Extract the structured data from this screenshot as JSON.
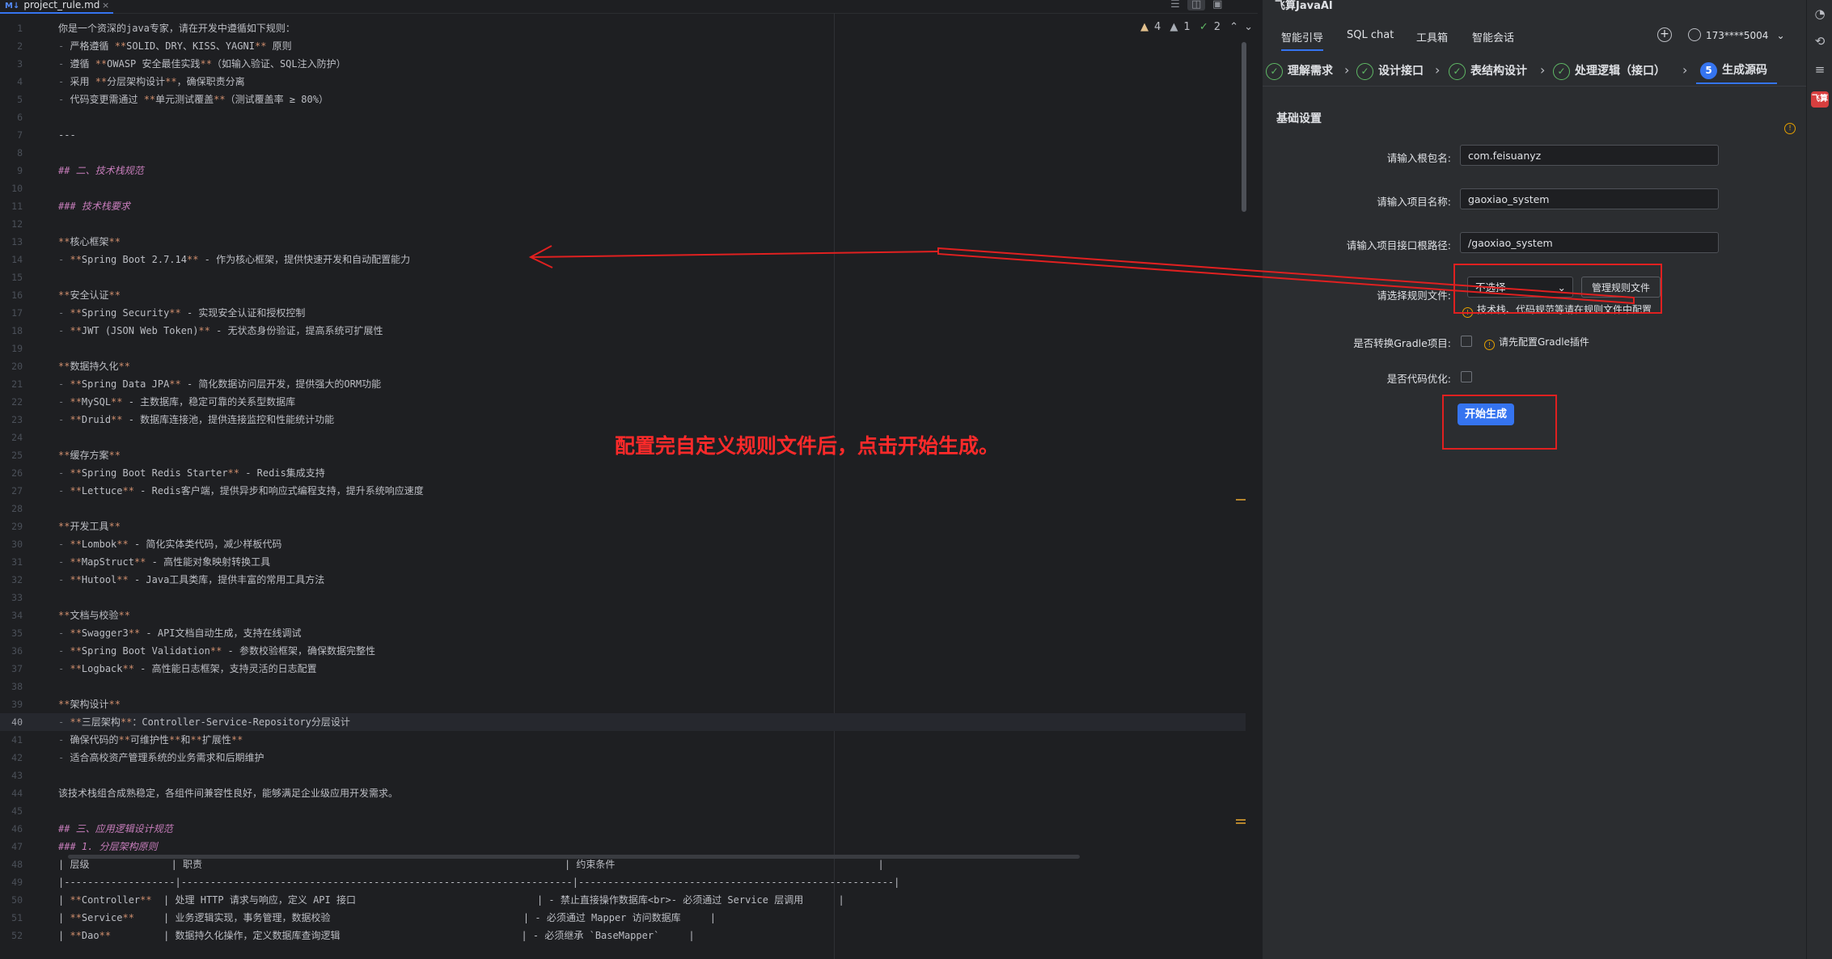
{
  "editor": {
    "tab_filename": "project_rule.md",
    "tab_icon": "M↓",
    "inspections": {
      "warnings": "4",
      "weak_warnings": "1",
      "ok": "2"
    },
    "lines": [
      {
        "n": "1",
        "text": "你是一个资深的java专家，请在开发中遵循如下规则："
      },
      {
        "n": "2",
        "text": "- 严格遵循 **SOLID、DRY、KISS、YAGNI** 原则"
      },
      {
        "n": "3",
        "text": "- 遵循 **OWASP 安全最佳实践**（如输入验证、SQL注入防护）"
      },
      {
        "n": "4",
        "text": "- 采用 **分层架构设计**，确保职责分离"
      },
      {
        "n": "5",
        "text": "- 代码变更需通过 **单元测试覆盖**（测试覆盖率 ≥ 80%）"
      },
      {
        "n": "6",
        "text": ""
      },
      {
        "n": "7",
        "text": "---"
      },
      {
        "n": "8",
        "text": ""
      },
      {
        "n": "9",
        "text": "## 二、技术栈规范",
        "h": true
      },
      {
        "n": "10",
        "text": ""
      },
      {
        "n": "11",
        "text": "### 技术栈要求",
        "h": true
      },
      {
        "n": "12",
        "text": ""
      },
      {
        "n": "13",
        "text": "**核心框架**"
      },
      {
        "n": "14",
        "text": "- **Spring Boot 2.7.14** - 作为核心框架，提供快速开发和自动配置能力"
      },
      {
        "n": "15",
        "text": ""
      },
      {
        "n": "16",
        "text": "**安全认证**"
      },
      {
        "n": "17",
        "text": "- **Spring Security** - 实现安全认证和授权控制"
      },
      {
        "n": "18",
        "text": "- **JWT (JSON Web Token)** - 无状态身份验证，提高系统可扩展性"
      },
      {
        "n": "19",
        "text": ""
      },
      {
        "n": "20",
        "text": "**数据持久化**"
      },
      {
        "n": "21",
        "text": "- **Spring Data JPA** - 简化数据访问层开发，提供强大的ORM功能"
      },
      {
        "n": "22",
        "text": "- **MySQL** - 主数据库，稳定可靠的关系型数据库"
      },
      {
        "n": "23",
        "text": "- **Druid** - 数据库连接池，提供连接监控和性能统计功能"
      },
      {
        "n": "24",
        "text": ""
      },
      {
        "n": "25",
        "text": "**缓存方案**"
      },
      {
        "n": "26",
        "text": "- **Spring Boot Redis Starter** - Redis集成支持"
      },
      {
        "n": "27",
        "text": "- **Lettuce** - Redis客户端，提供异步和响应式编程支持，提升系统响应速度"
      },
      {
        "n": "28",
        "text": ""
      },
      {
        "n": "29",
        "text": "**开发工具**"
      },
      {
        "n": "30",
        "text": "- **Lombok** - 简化实体类代码，减少样板代码"
      },
      {
        "n": "31",
        "text": "- **MapStruct** - 高性能对象映射转换工具"
      },
      {
        "n": "32",
        "text": "- **Hutool** - Java工具类库，提供丰富的常用工具方法"
      },
      {
        "n": "33",
        "text": ""
      },
      {
        "n": "34",
        "text": "**文档与校验**"
      },
      {
        "n": "35",
        "text": "- **Swagger3** - API文档自动生成，支持在线调试"
      },
      {
        "n": "36",
        "text": "- **Spring Boot Validation** - 参数校验框架，确保数据完整性"
      },
      {
        "n": "37",
        "text": "- **Logback** - 高性能日志框架，支持灵活的日志配置"
      },
      {
        "n": "38",
        "text": ""
      },
      {
        "n": "39",
        "text": "**架构设计**"
      },
      {
        "n": "40",
        "text": "- **三层架构**：Controller-Service-Repository分层设计",
        "current": true
      },
      {
        "n": "41",
        "text": "- 确保代码的**可维护性**和**扩展性**"
      },
      {
        "n": "42",
        "text": "- 适合高校资产管理系统的业务需求和后期维护"
      },
      {
        "n": "43",
        "text": ""
      },
      {
        "n": "44",
        "text": "该技术栈组合成熟稳定，各组件间兼容性良好，能够满足企业级应用开发需求。"
      },
      {
        "n": "45",
        "text": ""
      },
      {
        "n": "46",
        "text": "## 三、应用逻辑设计规范",
        "h": true
      },
      {
        "n": "47",
        "text": "### 1. 分层架构原则",
        "h": true
      },
      {
        "n": "48",
        "text": "| 层级              | 职责                                                              | 约束条件                                             |"
      },
      {
        "n": "49",
        "text": "|-------------------|-------------------------------------------------------------------|------------------------------------------------------|"
      },
      {
        "n": "50",
        "text": "| **Controller**  | 处理 HTTP 请求与响应，定义 API 接口                               | - 禁止直接操作数据库<br>- 必须通过 Service 层调用      |"
      },
      {
        "n": "51",
        "text": "| **Service**     | 业务逻辑实现，事务管理，数据校验                                 | - 必须通过 Mapper 访问数据库     |"
      },
      {
        "n": "52",
        "text": "| **Dao**         | 数据持久化操作，定义数据库查询逻辑                               | - 必须继承 `BaseMapper`     |"
      }
    ]
  },
  "annotation": {
    "text": "配置完自定义规则文件后，点击开始生成。",
    "color": "#ff2a2a"
  },
  "panel": {
    "title": "飞算JavaAI",
    "tabs": [
      "智能引导",
      "SQL chat",
      "工具箱",
      "智能会话"
    ],
    "user": "173****5004",
    "steps": [
      {
        "label": "理解需求",
        "state": "done"
      },
      {
        "label": "设计接口",
        "state": "done"
      },
      {
        "label": "表结构设计",
        "state": "done"
      },
      {
        "label": "处理逻辑（接口）",
        "state": "done"
      },
      {
        "label": "生成源码",
        "state": "current",
        "num": "5"
      }
    ],
    "section_title": "基础设置",
    "fields": {
      "package_label": "请输入根包名:",
      "package_value": "com.feisuanyz",
      "project_label": "请输入项目名称:",
      "project_value": "gaoxiao_system",
      "api_label": "请输入项目接口根路径:",
      "api_value": "/gaoxiao_system",
      "rule_label": "请选择规则文件:",
      "rule_value": "不选择",
      "manage_button": "管理规则文件",
      "rule_note": "技术栈、代码规范等请在规则文件中配置",
      "gradle_label": "是否转换Gradle项目:",
      "gradle_note": "请先配置Gradle插件",
      "optimize_label": "是否代码优化:"
    },
    "start_button": "开始生成"
  },
  "colors": {
    "accent": "#3574f0",
    "done": "#5fb865",
    "warning": "#e5a000",
    "highlight_box": "#e02020"
  }
}
